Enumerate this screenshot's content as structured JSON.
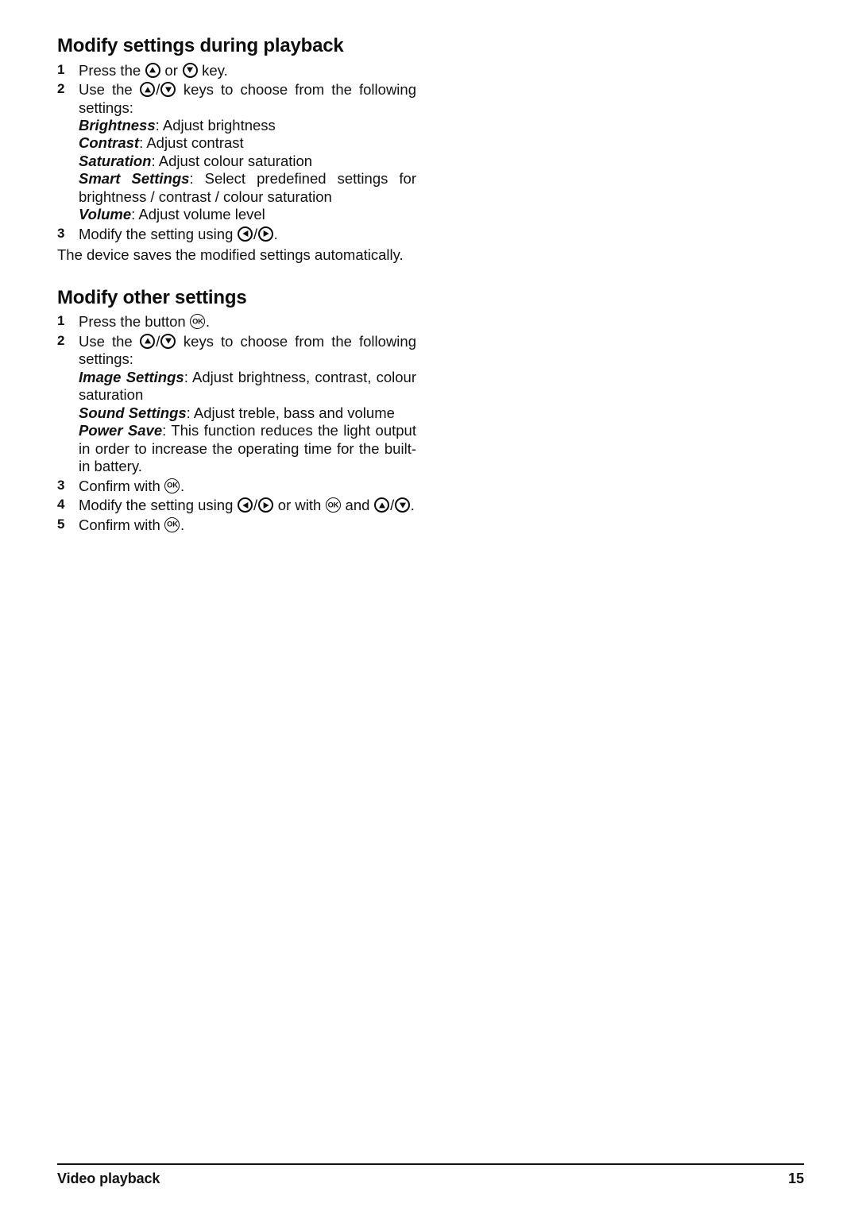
{
  "page": {
    "background": "#ffffff",
    "text_color": "#111111"
  },
  "sections": [
    {
      "heading": "Modify settings during playback",
      "steps": [
        {
          "number": "1",
          "parts": [
            "Press the ",
            "KEY_UP",
            " or ",
            "KEY_DOWN",
            " key."
          ]
        },
        {
          "number": "2",
          "parts": [
            "Use the ",
            "KEY_UP",
            "/",
            "KEY_DOWN",
            " keys to choose from the following settings:"
          ],
          "definitions": [
            {
              "term": "Brightness",
              "desc": ": Adjust brightness"
            },
            {
              "term": "Contrast",
              "desc": ": Adjust contrast"
            },
            {
              "term": "Saturation",
              "desc": ": Adjust colour saturation"
            },
            {
              "term": "Smart Settings",
              "desc": ": Select predefined settings for brightness / contrast / colour saturation"
            },
            {
              "term": "Volume",
              "desc": ": Adjust volume level"
            }
          ]
        },
        {
          "number": "3",
          "parts": [
            "Modify the setting using ",
            "KEY_LEFT",
            "/",
            "KEY_RIGHT",
            "."
          ]
        }
      ],
      "note": "The device saves the modified settings automatically."
    },
    {
      "heading": "Modify other settings",
      "steps": [
        {
          "number": "1",
          "parts": [
            "Press the button ",
            "KEY_OK",
            "."
          ]
        },
        {
          "number": "2",
          "parts": [
            "Use the ",
            "KEY_UP",
            "/",
            "KEY_DOWN",
            " keys to choose from the following settings:"
          ],
          "definitions": [
            {
              "term": "Image Settings",
              "desc": ": Adjust brightness, contrast, colour saturation"
            },
            {
              "term": "Sound Settings",
              "desc": ": Adjust treble, bass and volume"
            },
            {
              "term": "Power Save",
              "desc": ": This function reduces the light output in order to increase the operating time for the built-in battery."
            }
          ]
        },
        {
          "number": "3",
          "parts": [
            "Confirm with ",
            "KEY_OK",
            "."
          ]
        },
        {
          "number": "4",
          "parts": [
            "Modify the setting using ",
            "KEY_LEFT",
            "/",
            "KEY_RIGHT",
            " or with ",
            "KEY_OK",
            " and ",
            "KEY_UP",
            "/",
            "KEY_DOWN",
            "."
          ]
        },
        {
          "number": "5",
          "parts": [
            "Confirm with ",
            "KEY_OK",
            "."
          ]
        }
      ]
    }
  ],
  "icons": {
    "up_label": "up-arrow-key-icon",
    "down_label": "down-arrow-key-icon",
    "left_label": "left-arrow-key-icon",
    "right_label": "right-arrow-key-icon",
    "ok_label": "OK"
  },
  "footer": {
    "left": "Video playback",
    "right": "15"
  },
  "text_fragments": {
    "s1_step1_a": "Press the ",
    "s1_step1_or": " or ",
    "s1_step1_b": " key.",
    "use_the": "Use the ",
    "slash": "/",
    "keys_choose": " keys to choose from the following settings:",
    "s1_step3_a": "Modify the setting using ",
    "period": ".",
    "s2_step1_a": "Press the button ",
    "confirm_with": "Confirm with ",
    "s2_step4_a": "Modify the setting using ",
    "s2_step4_or_with": " or with ",
    "s2_step4_and": " and "
  }
}
